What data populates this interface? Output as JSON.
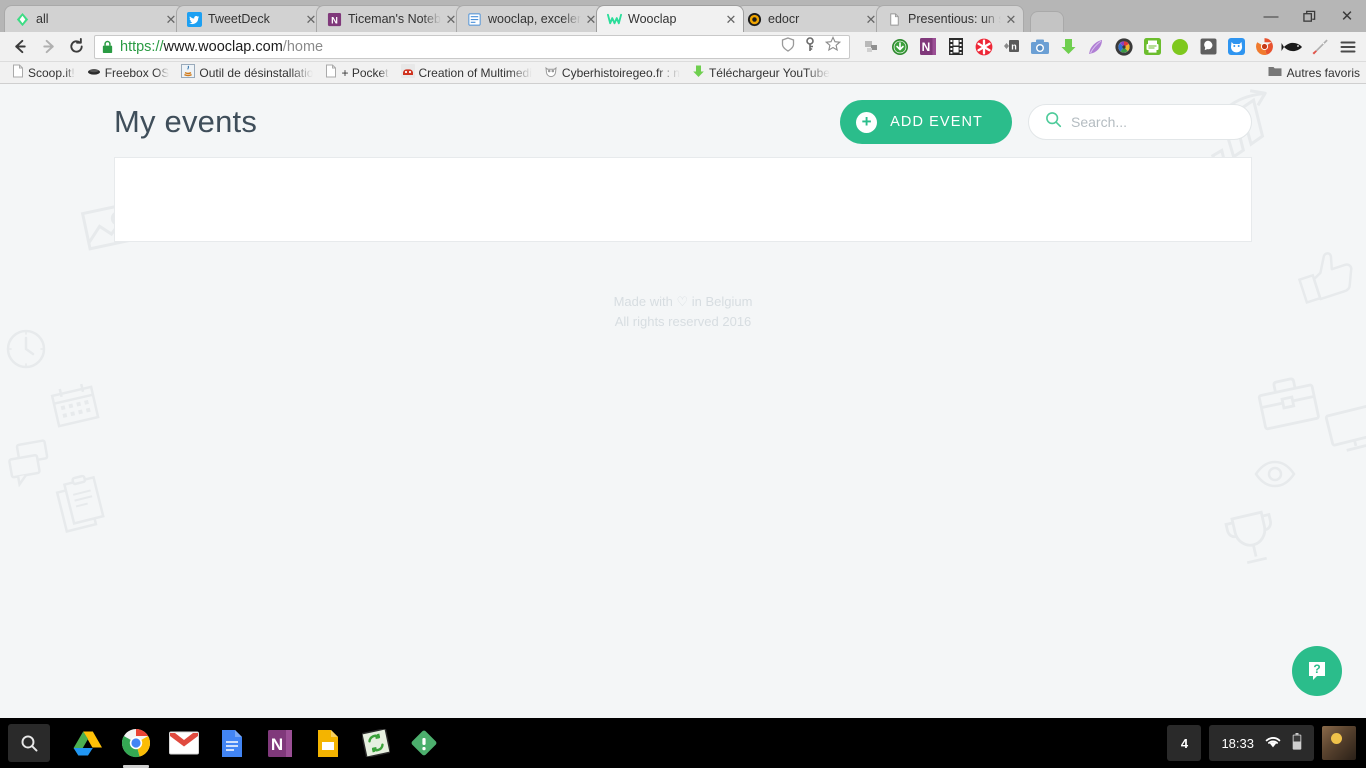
{
  "browser": {
    "tabs": [
      {
        "label": "all",
        "favicon": "diamond-icon",
        "active": false
      },
      {
        "label": "TweetDeck",
        "favicon": "twitter-icon",
        "active": false
      },
      {
        "label": "Ticeman's Notebook -",
        "favicon": "onenote-icon",
        "active": false
      },
      {
        "label": "wooclap, excelente for",
        "favicon": "document-icon",
        "active": false
      },
      {
        "label": "Wooclap",
        "favicon": "wooclap-icon",
        "active": true
      },
      {
        "label": "edocr",
        "favicon": "edocr-icon",
        "active": false
      },
      {
        "label": "Presentious: un servic",
        "favicon": "page-icon",
        "active": false
      }
    ],
    "close_glyph": "✕",
    "window_controls": {
      "minimize": "—",
      "restore": "❐",
      "close": "✕"
    },
    "nav": {
      "back": "←",
      "forward": "→",
      "reload": "↻"
    },
    "omnibox": {
      "scheme": "https://",
      "host": "www.wooclap.com",
      "path": "/home",
      "lock": "lock-icon",
      "right_icons": [
        "shield-icon",
        "key-icon",
        "star-icon"
      ]
    },
    "extensions": [
      "cast-icon",
      "download-green-icon",
      "onenote-clipper-icon",
      "film-strip-icon",
      "asterisk-red-icon",
      "evernote-clipper-icon",
      "camera-icon",
      "download-arrow-icon",
      "feather-icon",
      "color-lens-icon",
      "printer-green-icon",
      "green-circle-icon",
      "speech-bubble-icon",
      "wolf-icon",
      "chrome-orange-icon",
      "fish-icon",
      "brush-icon"
    ],
    "menu_icon": "hamburger-menu-icon",
    "bookmarks": [
      {
        "label": "Scoop.it!",
        "favicon": "page-icon"
      },
      {
        "label": "Freebox OS",
        "favicon": "freebox-icon"
      },
      {
        "label": "Outil de désinstallatio",
        "favicon": "java-icon"
      },
      {
        "label": "+ Pocket",
        "favicon": "page-icon"
      },
      {
        "label": "Creation of Multimedi",
        "favicon": "red-icon"
      },
      {
        "label": "Cyberhistoiregeo.fr : n",
        "favicon": "owl-icon"
      },
      {
        "label": "Téléchargeur YouTube",
        "favicon": "download-green-icon"
      }
    ],
    "other_bookmarks": {
      "label": "Autres favoris",
      "icon": "folder-icon"
    }
  },
  "page": {
    "title": "My events",
    "add_event_label": "ADD EVENT",
    "add_event_icon": "plus-circle-icon",
    "search": {
      "placeholder": "Search...",
      "value": "",
      "icon": "search-icon"
    },
    "events_card": {
      "empty": true
    },
    "footer": {
      "line1_prefix": "Made with ",
      "heart": "♡",
      "line1_suffix": " in Belgium",
      "line2": "All rights reserved 2016"
    },
    "help_button": {
      "icon": "help-bubble-icon",
      "glyph": "?"
    },
    "watermarks": [
      "photo-icon",
      "clock-icon",
      "calendar-icon",
      "speech-bubbles-icon",
      "documents-icon",
      "bar-chart-arrow-icon",
      "thumbs-up-icon",
      "briefcase-icon",
      "monitor-icon",
      "eye-icon",
      "trophy-icon"
    ],
    "colors": {
      "accent_green": "#2bbd8b",
      "page_background": "#f4f6f7",
      "title_color": "#3f4e5a",
      "footer_color": "#d7dde1",
      "watermark_color": "#e7eaec"
    }
  },
  "taskbar": {
    "search_icon": "search-icon",
    "apps": [
      {
        "name": "google-drive-icon",
        "active": false
      },
      {
        "name": "google-chrome-icon",
        "active": true
      },
      {
        "name": "gmail-icon",
        "active": false
      },
      {
        "name": "google-docs-icon",
        "active": false
      },
      {
        "name": "onenote-icon",
        "active": false
      },
      {
        "name": "google-slides-icon",
        "active": false
      },
      {
        "name": "sync-green-icon",
        "active": false
      },
      {
        "name": "feedly-icon",
        "active": false
      }
    ],
    "tray": {
      "badge": "4",
      "time": "18:33",
      "wifi_icon": "wifi-icon",
      "battery_icon": "battery-icon",
      "avatar": "user-avatar"
    }
  }
}
